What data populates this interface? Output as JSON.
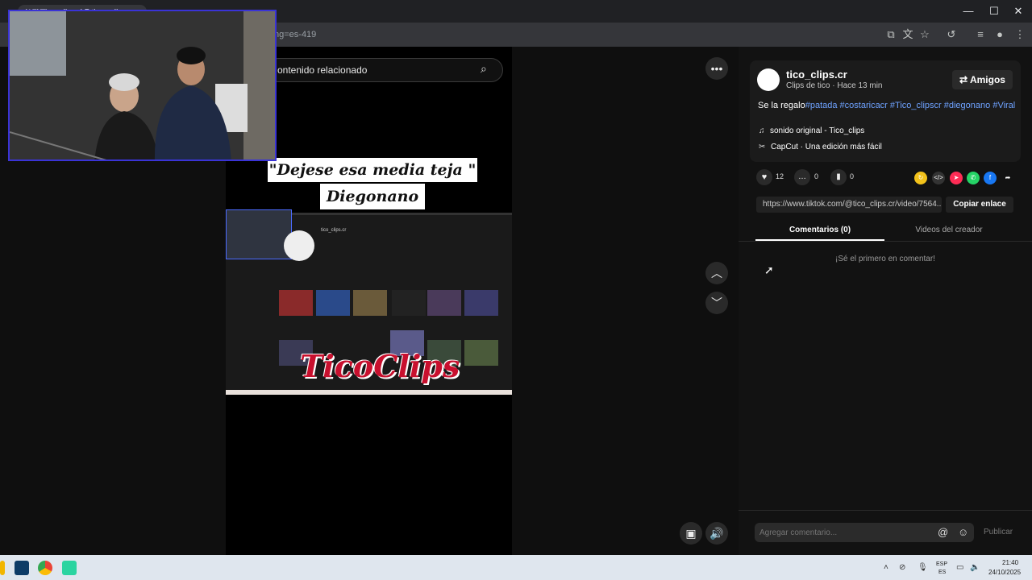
{
  "browser": {
    "tab_title": "(17)Tico clips (@tico_clips",
    "url": "ng=es-419"
  },
  "player": {
    "search_placeholder": "ontenido relacionado",
    "caption_line1": "\"Dejese esa media teja \"",
    "caption_line2": "Diegonano",
    "inner_screen": {
      "channel_name": "tico_clips.cr",
      "overlay_logo_text": "TicoClips"
    },
    "more_icon": "ellipsis-icon",
    "prev_icon": "chevron-up-icon",
    "next_icon": "chevron-down-icon"
  },
  "post": {
    "author": "tico_clips.cr",
    "subtitle": "Clips de tico · Hace 13 min",
    "friends_button": "Amigos",
    "desc_text": "Se la regalo",
    "hashtags": [
      "#patada",
      "#costaricacr",
      "#Tico_clipscr",
      "#diegonano",
      "#Viral"
    ],
    "sound": "sonido original - Tico_clips",
    "capcut": "CapCut · Una edición más fácil",
    "likes": "12",
    "comments": "0",
    "saves": "0",
    "link": "https://www.tiktok.com/@tico_clips.cr/video/7564...",
    "copy_button": "Copiar enlace",
    "tabs": [
      "Comentarios (0)",
      "Videos del creador"
    ],
    "empty_message": "¡Sé el primero en comentar!",
    "comment_placeholder": "Agregar comentario...",
    "post_button": "Publicar"
  },
  "taskbar": {
    "lang_line1": "ESP",
    "lang_line2": "ES",
    "time": "21:40",
    "date": "24/10/2025"
  }
}
